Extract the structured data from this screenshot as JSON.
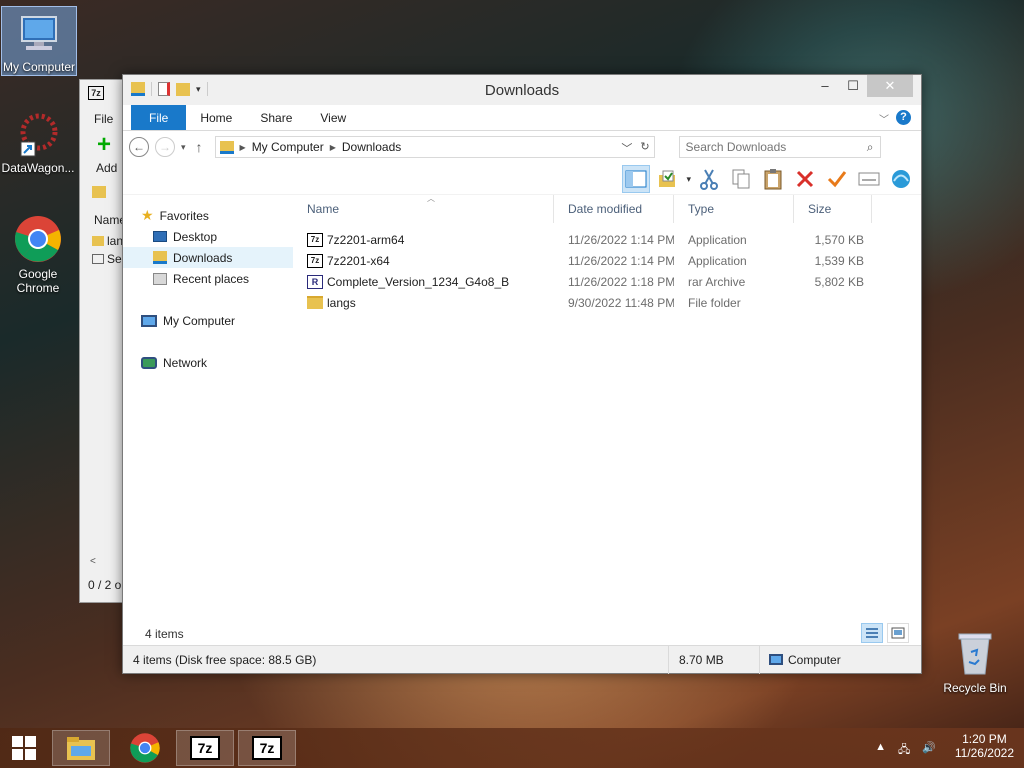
{
  "desktop": {
    "icons": [
      {
        "label": "My Computer"
      },
      {
        "label": "DataWagon..."
      },
      {
        "label": "Google Chrome"
      },
      {
        "label": "Recycle Bin"
      }
    ]
  },
  "bg_window": {
    "menu_file": "File",
    "add_label": "Add",
    "col_name": "Name",
    "row1": "lan",
    "row2": "Se",
    "status": "0 / 2 o"
  },
  "explorer": {
    "title": "Downloads",
    "tabs": [
      "File",
      "Home",
      "Share",
      "View"
    ],
    "help": "?",
    "breadcrumb": [
      "My Computer",
      "Downloads"
    ],
    "search_placeholder": "Search Downloads",
    "nav": {
      "favorites": "Favorites",
      "desktop": "Desktop",
      "downloads": "Downloads",
      "recent": "Recent places",
      "computer": "My Computer",
      "network": "Network"
    },
    "columns": [
      "Name",
      "Date modified",
      "Type",
      "Size"
    ],
    "files": [
      {
        "name": "7z2201-arm64",
        "date": "11/26/2022 1:14 PM",
        "type": "Application",
        "size": "1,570 KB",
        "icon": "7z-app-icon"
      },
      {
        "name": "7z2201-x64",
        "date": "11/26/2022 1:14 PM",
        "type": "Application",
        "size": "1,539 KB",
        "icon": "7z-app-icon"
      },
      {
        "name": "Complete_Version_1234_G4o8_B",
        "date": "11/26/2022 1:18 PM",
        "type": "rar Archive",
        "size": "5,802 KB",
        "icon": "rar-archive-icon"
      },
      {
        "name": "langs",
        "date": "9/30/2022 11:48 PM",
        "type": "File folder",
        "size": "",
        "icon": "folder-icon"
      }
    ],
    "item_count": "4 items",
    "status": {
      "left": "4 items (Disk free space: 88.5 GB)",
      "size": "8.70 MB",
      "location": "Computer"
    }
  },
  "taskbar": {
    "time": "1:20 PM",
    "date": "11/26/2022"
  },
  "colors": {
    "accent": "#1979ca",
    "selection": "#cce4f7"
  }
}
